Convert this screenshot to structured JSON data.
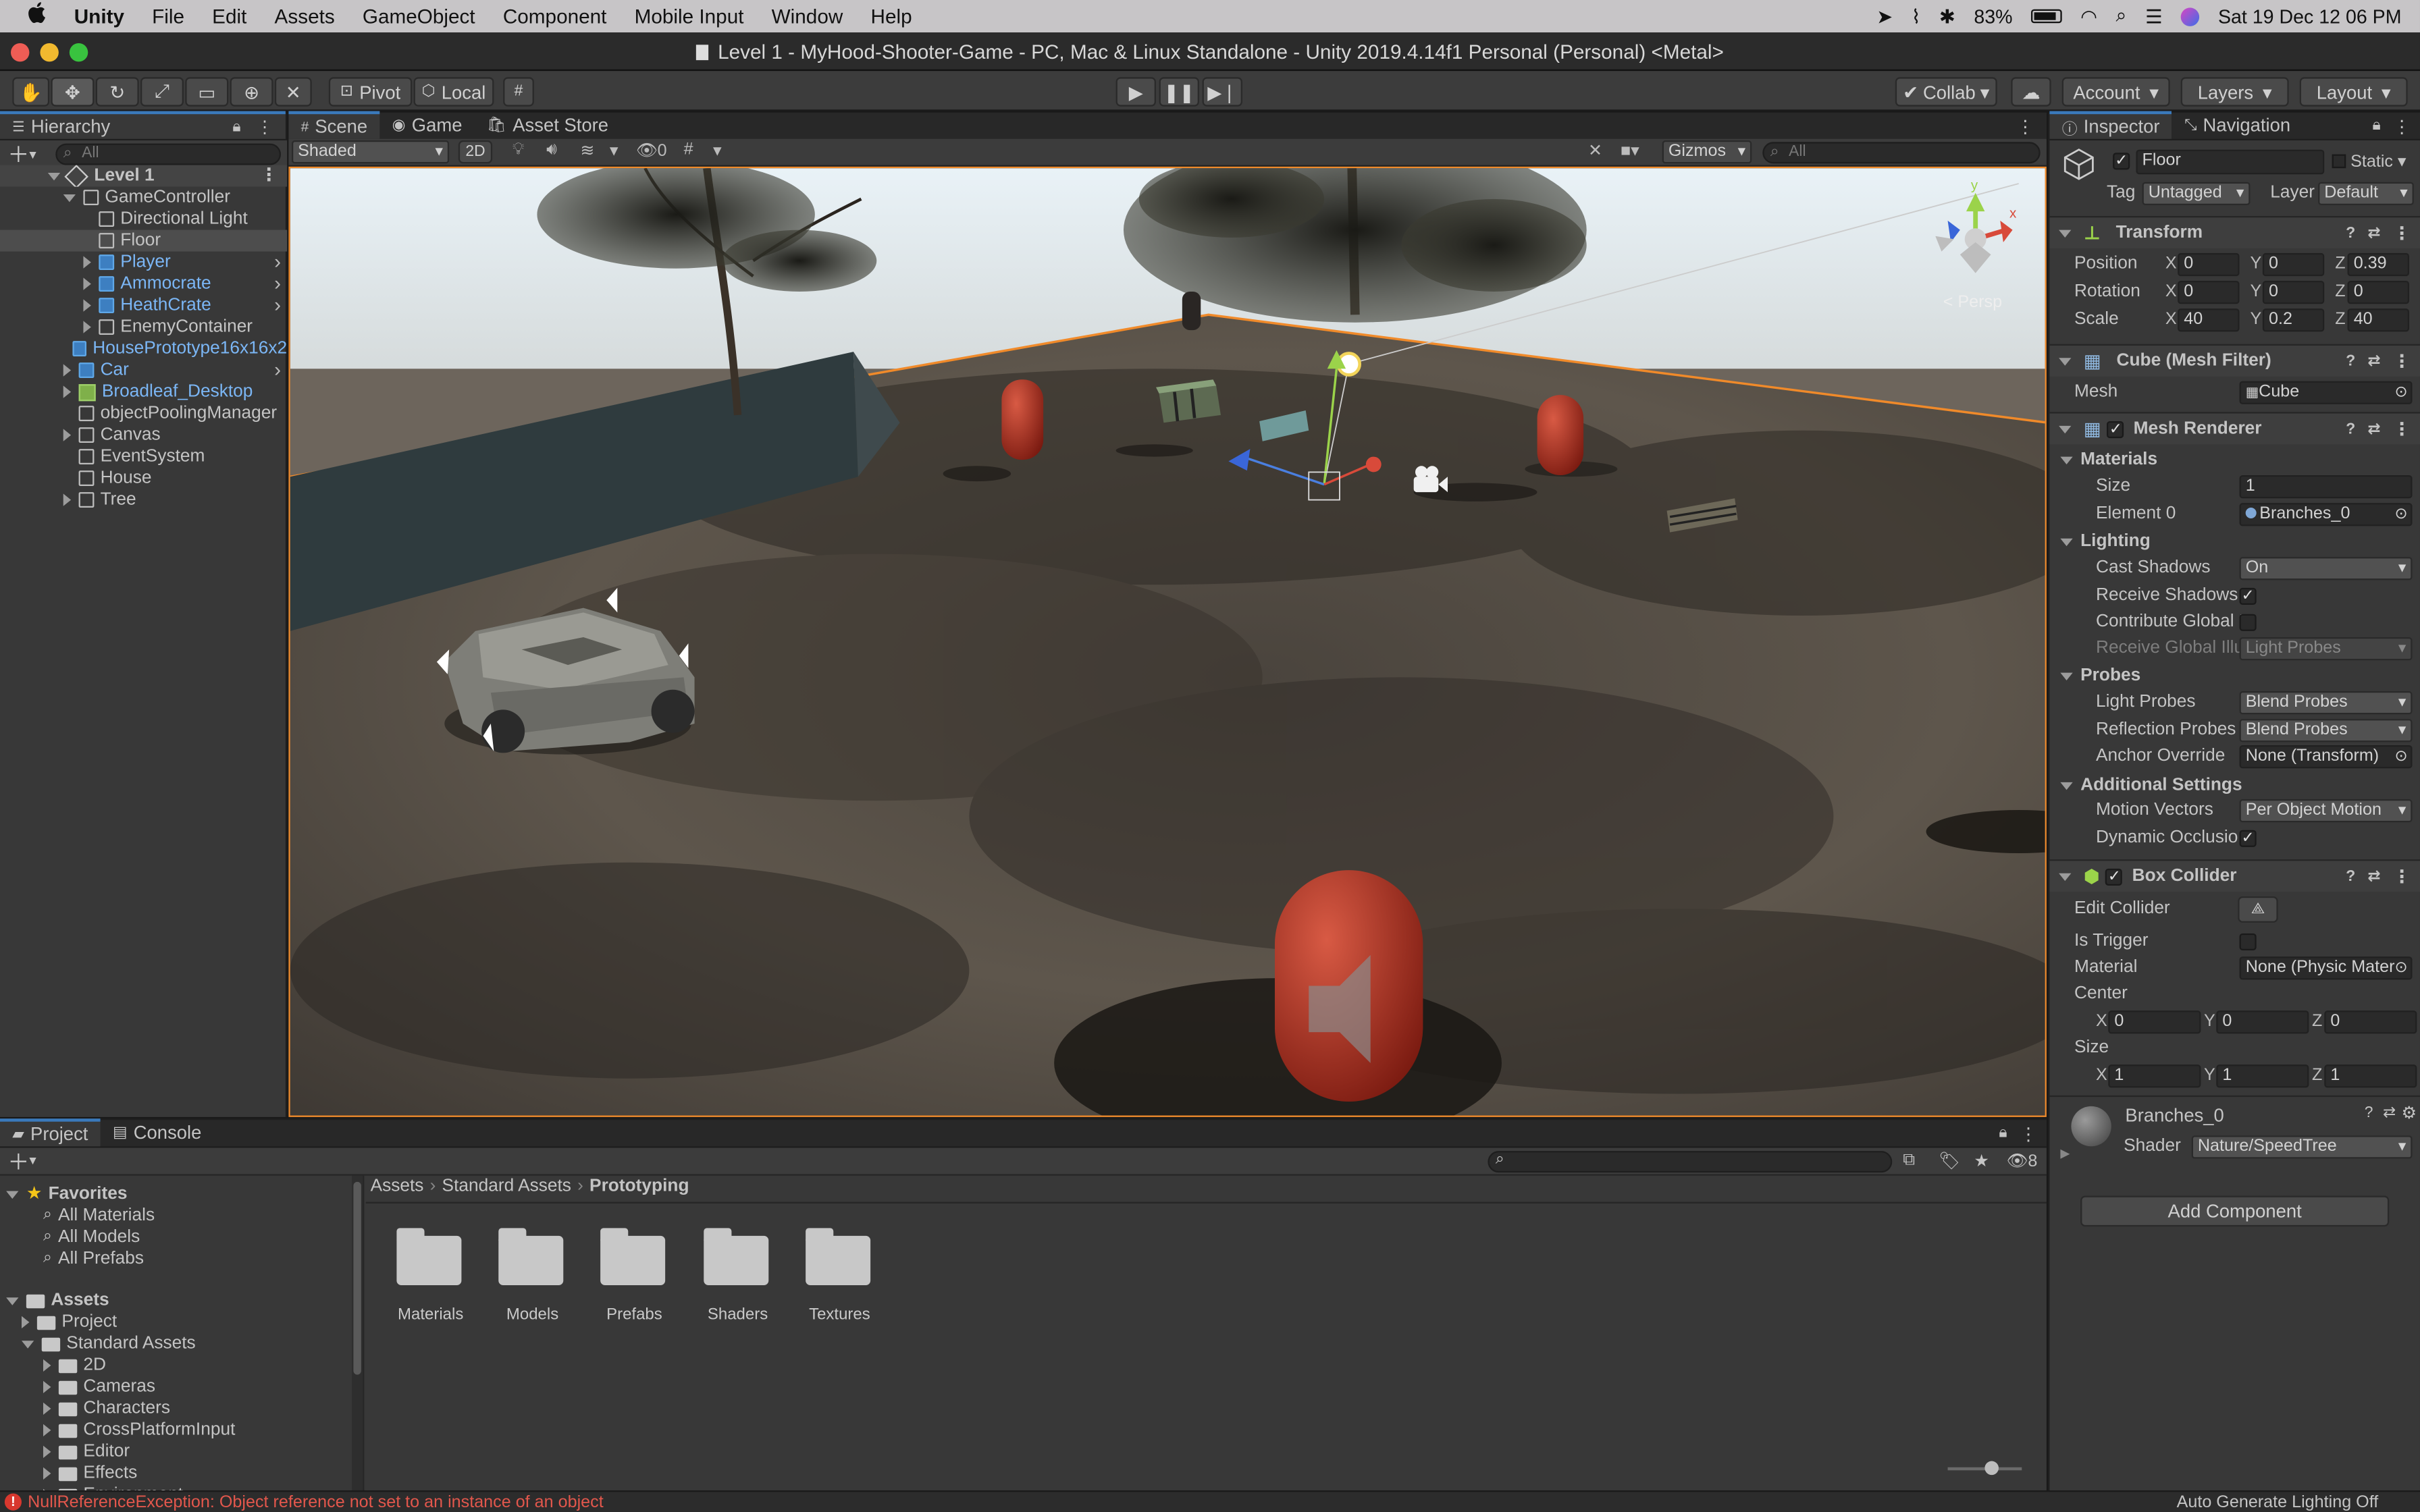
{
  "menubar": {
    "app": "Unity",
    "items": [
      "File",
      "Edit",
      "Assets",
      "GameObject",
      "Component",
      "Mobile Input",
      "Window",
      "Help"
    ],
    "battery": "83%",
    "datetime": "Sat 19 Dec  12 06 PM"
  },
  "window": {
    "title": "Level 1 - MyHood-Shooter-Game - PC, Mac & Linux Standalone - Unity 2019.4.14f1 Personal (Personal) <Metal>"
  },
  "toolbar": {
    "pivot": "Pivot",
    "local": "Local",
    "collab": "Collab",
    "account": "Account",
    "layers": "Layers",
    "layout": "Layout"
  },
  "hierarchy": {
    "tab": "Hierarchy",
    "search_placeholder": "All",
    "scene": "Level 1",
    "items": [
      {
        "label": "GameController",
        "indent": 1,
        "expanded": true,
        "prefab": false
      },
      {
        "label": "Directional Light",
        "indent": 2,
        "prefab": false
      },
      {
        "label": "Floor",
        "indent": 2,
        "prefab": false,
        "selected": true
      },
      {
        "label": "Player",
        "indent": 2,
        "prefab": true
      },
      {
        "label": "Ammocrate",
        "indent": 2,
        "prefab": true
      },
      {
        "label": "HeathCrate",
        "indent": 2,
        "prefab": true
      },
      {
        "label": "EnemyContainer",
        "indent": 2,
        "prefab": false
      },
      {
        "label": "HousePrototype16x16x2",
        "indent": 1,
        "prefab": true
      },
      {
        "label": "Car",
        "indent": 1,
        "prefab": true
      },
      {
        "label": "Broadleaf_Desktop",
        "indent": 1,
        "prefab": true
      },
      {
        "label": "objectPoolingManager",
        "indent": 1,
        "prefab": false
      },
      {
        "label": "Canvas",
        "indent": 1,
        "prefab": false
      },
      {
        "label": "EventSystem",
        "indent": 1,
        "prefab": false
      },
      {
        "label": "House",
        "indent": 1,
        "prefab": false
      },
      {
        "label": "Tree",
        "indent": 1,
        "prefab": false
      }
    ]
  },
  "scene": {
    "tabs": [
      "Scene",
      "Game",
      "Asset Store"
    ],
    "shading": "Shaded",
    "mode2d": "2D",
    "fx_count": "0",
    "gizmos": "Gizmos",
    "search_placeholder": "All",
    "persp": "Persp",
    "axis_x": "x",
    "axis_y": "y"
  },
  "inspector": {
    "tabs": [
      "Inspector",
      "Navigation"
    ],
    "object_name": "Floor",
    "static_label": "Static",
    "tag_label": "Tag",
    "tag_value": "Untagged",
    "layer_label": "Layer",
    "layer_value": "Default",
    "transform": {
      "title": "Transform",
      "position_label": "Position",
      "rotation_label": "Rotation",
      "scale_label": "Scale",
      "position": [
        "0",
        "0",
        "0.39"
      ],
      "rotation": [
        "0",
        "0",
        "0"
      ],
      "scale": [
        "40",
        "0.2",
        "40"
      ]
    },
    "mesh_filter": {
      "title": "Cube (Mesh Filter)",
      "mesh_label": "Mesh",
      "mesh_value": "Cube"
    },
    "mesh_renderer": {
      "title": "Mesh Renderer",
      "materials": "Materials",
      "size_label": "Size",
      "size_value": "1",
      "element0_label": "Element 0",
      "element0_value": "Branches_0",
      "lighting": "Lighting",
      "cast_shadows_label": "Cast Shadows",
      "cast_shadows_value": "On",
      "receive_shadows_label": "Receive Shadows",
      "contribute_gi_label": "Contribute Global I",
      "receive_gi_label": "Receive Global Illu",
      "receive_gi_value": "Light Probes",
      "probes": "Probes",
      "light_probes_label": "Light Probes",
      "light_probes_value": "Blend Probes",
      "reflection_probes_label": "Reflection Probes",
      "reflection_probes_value": "Blend Probes",
      "anchor_override_label": "Anchor Override",
      "anchor_override_value": "None (Transform)",
      "additional_settings": "Additional Settings",
      "motion_vectors_label": "Motion Vectors",
      "motion_vectors_value": "Per Object Motion",
      "dynamic_occlusion_label": "Dynamic Occlusio"
    },
    "box_collider": {
      "title": "Box Collider",
      "edit_collider_label": "Edit Collider",
      "is_trigger_label": "Is Trigger",
      "material_label": "Material",
      "material_value": "None (Physic Materi",
      "center_label": "Center",
      "center": [
        "0",
        "0",
        "0"
      ],
      "size_label": "Size",
      "size": [
        "1",
        "1",
        "1"
      ]
    },
    "material": {
      "name": "Branches_0",
      "shader_label": "Shader",
      "shader_value": "Nature/SpeedTree"
    },
    "add_component": "Add Component"
  },
  "project": {
    "tabs": [
      "Project",
      "Console"
    ],
    "hidden_count": "8",
    "favorites": "Favorites",
    "favorite_items": [
      "All Materials",
      "All Models",
      "All Prefabs"
    ],
    "assets": "Assets",
    "tree": [
      {
        "label": "Project",
        "indent": 1
      },
      {
        "label": "Standard Assets",
        "indent": 1,
        "expanded": true
      },
      {
        "label": "2D",
        "indent": 2
      },
      {
        "label": "Cameras",
        "indent": 2
      },
      {
        "label": "Characters",
        "indent": 2
      },
      {
        "label": "CrossPlatformInput",
        "indent": 2
      },
      {
        "label": "Editor",
        "indent": 2
      },
      {
        "label": "Effects",
        "indent": 2
      },
      {
        "label": "Environment",
        "indent": 2
      }
    ],
    "breadcrumb": [
      "Assets",
      "Standard Assets",
      "Prototyping"
    ],
    "folders": [
      "Materials",
      "Models",
      "Prefabs",
      "Shaders",
      "Textures"
    ]
  },
  "status": {
    "error": "NullReferenceException: Object reference not set to an instance of an object",
    "right": "Auto Generate Lighting Off"
  }
}
